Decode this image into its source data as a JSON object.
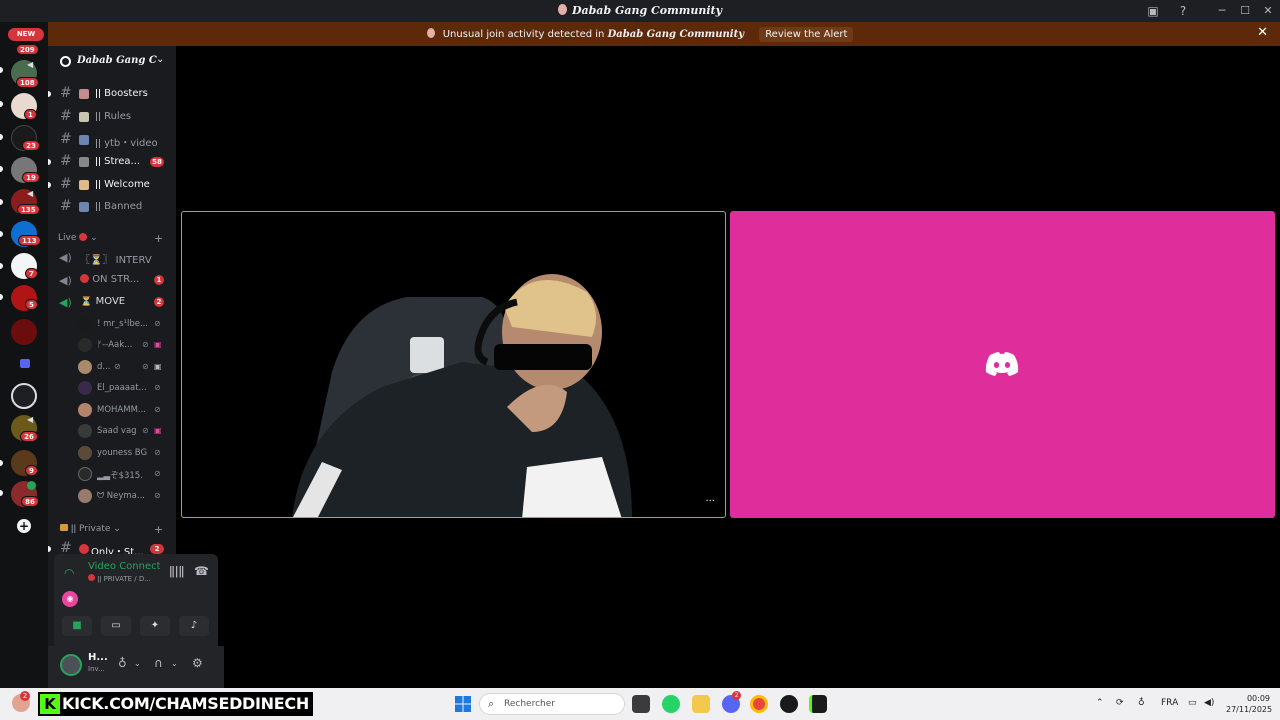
{
  "window": {
    "title": "Dabab Gang Community",
    "icons": [
      "inbox-icon",
      "help-icon",
      "minimize-icon",
      "maximize-icon",
      "close-icon"
    ]
  },
  "alert": {
    "text": "Unusual join activity detected in",
    "guild": "Dabab Gang Community",
    "action": "Review the Alert"
  },
  "rail": {
    "new_label": "NEW",
    "badges": [
      "209",
      "108",
      "1",
      "23",
      "19",
      "135",
      "113",
      "7",
      "5",
      "26",
      "9",
      "86"
    ]
  },
  "guild": {
    "name": "Dabab Gang Community"
  },
  "channels": [
    {
      "label": "Boosters",
      "prefix": "ǀǀ",
      "bright": true,
      "badge": ""
    },
    {
      "label": "Rules",
      "prefix": "ǀǀ",
      "bright": false,
      "badge": ""
    },
    {
      "label": "ytb・videos",
      "prefix": "ǀǀ",
      "bright": false,
      "badge": ""
    },
    {
      "label": "Strea...",
      "prefix": "ǀǀ",
      "bright": true,
      "badge": "58"
    },
    {
      "label": "Welcome",
      "prefix": "ǀǀ",
      "bright": true,
      "badge": ""
    },
    {
      "label": "Banned",
      "prefix": "ǀǀ",
      "bright": false,
      "badge": ""
    }
  ],
  "categories": {
    "live": "Live",
    "private": "Private"
  },
  "voice_channels": [
    {
      "label": "〖⏳〗 INTERVI...",
      "badge": ""
    },
    {
      "label": "ON STR...",
      "badge": "1"
    },
    {
      "label": "MOVE",
      "badge": "2"
    }
  ],
  "voice_users": [
    {
      "name": "! mr_s¹lbe..."
    },
    {
      "name": "ᚠ--Aak..."
    },
    {
      "name": "d..."
    },
    {
      "name": "El_paaaat..."
    },
    {
      "name": "MOHAMM..."
    },
    {
      "name": "Saad vag"
    },
    {
      "name": "youness BG"
    },
    {
      "name": "▂▃ぞ$315..."
    },
    {
      "name": "Neyma..."
    }
  ],
  "private_channel": {
    "label": "Only・St...",
    "badge": "2"
  },
  "voice_panel": {
    "status": "Video Connected",
    "sub": "ǀǀ PRIVATE / D..."
  },
  "user_panel": {
    "name": "H...",
    "status": "Inv..."
  },
  "taskbar": {
    "stream_banner": "KICK.COM/CHAMSEDDINECH",
    "search_placeholder": "Rechercher",
    "lang": "FRA",
    "time": "00:09",
    "date": "27/11/2025",
    "notif_count": "2",
    "discord_badge": "2"
  },
  "colors": {
    "accent_pink": "#df2d9b",
    "speaking_green": "#5fc95f",
    "alert_bg": "#5c2a0b",
    "badge_red": "#d8343c"
  }
}
